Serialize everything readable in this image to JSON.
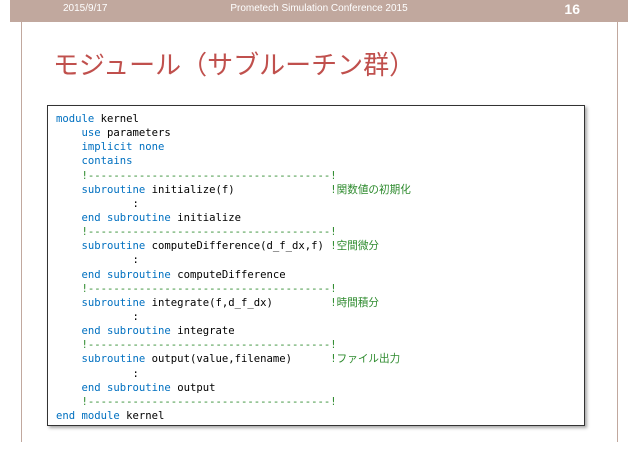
{
  "header": {
    "date": "2015/9/17",
    "conference": "Prometech Simulation Conference 2015",
    "page_number": "16"
  },
  "title": "モジュール（サブルーチン群）",
  "colors": {
    "header_bar": "#c1a89e",
    "title": "#c0504d",
    "keyword": "#0070c0",
    "comment": "#2e8b2e"
  },
  "code_lines": [
    [
      {
        "t": "module",
        "c": "kw"
      },
      {
        "t": " kernel",
        "c": ""
      }
    ],
    [
      {
        "t": "    ",
        "c": ""
      },
      {
        "t": "use",
        "c": "kw"
      },
      {
        "t": " parameters",
        "c": ""
      }
    ],
    [
      {
        "t": "    ",
        "c": ""
      },
      {
        "t": "implicit none",
        "c": "kw"
      }
    ],
    [
      {
        "t": "    ",
        "c": ""
      },
      {
        "t": "contains",
        "c": "kw"
      }
    ],
    [
      {
        "t": "    ",
        "c": ""
      },
      {
        "t": "!--------------------------------------!",
        "c": "cm"
      }
    ],
    [
      {
        "t": "    ",
        "c": ""
      },
      {
        "t": "subroutine",
        "c": "kw"
      },
      {
        "t": " initialize(f)               ",
        "c": ""
      },
      {
        "t": "!関数値の初期化",
        "c": "cm"
      }
    ],
    [
      {
        "t": "            :",
        "c": ""
      }
    ],
    [
      {
        "t": "    ",
        "c": ""
      },
      {
        "t": "end subroutine",
        "c": "kw"
      },
      {
        "t": " initialize",
        "c": ""
      }
    ],
    [
      {
        "t": "    ",
        "c": ""
      },
      {
        "t": "!--------------------------------------!",
        "c": "cm"
      }
    ],
    [
      {
        "t": "    ",
        "c": ""
      },
      {
        "t": "subroutine",
        "c": "kw"
      },
      {
        "t": " computeDifference(d_f_dx,f) ",
        "c": ""
      },
      {
        "t": "!空間微分",
        "c": "cm"
      }
    ],
    [
      {
        "t": "            :",
        "c": ""
      }
    ],
    [
      {
        "t": "    ",
        "c": ""
      },
      {
        "t": "end subroutine",
        "c": "kw"
      },
      {
        "t": " computeDifference",
        "c": ""
      }
    ],
    [
      {
        "t": "    ",
        "c": ""
      },
      {
        "t": "!--------------------------------------!",
        "c": "cm"
      }
    ],
    [
      {
        "t": "    ",
        "c": ""
      },
      {
        "t": "subroutine",
        "c": "kw"
      },
      {
        "t": " integrate(f,d_f_dx)         ",
        "c": ""
      },
      {
        "t": "!時間積分",
        "c": "cm"
      }
    ],
    [
      {
        "t": "            :",
        "c": ""
      }
    ],
    [
      {
        "t": "    ",
        "c": ""
      },
      {
        "t": "end subroutine",
        "c": "kw"
      },
      {
        "t": " integrate",
        "c": ""
      }
    ],
    [
      {
        "t": "    ",
        "c": ""
      },
      {
        "t": "!--------------------------------------!",
        "c": "cm"
      }
    ],
    [
      {
        "t": "    ",
        "c": ""
      },
      {
        "t": "subroutine",
        "c": "kw"
      },
      {
        "t": " output(value,filename)      ",
        "c": ""
      },
      {
        "t": "!ファイル出力",
        "c": "cm"
      }
    ],
    [
      {
        "t": "            :",
        "c": ""
      }
    ],
    [
      {
        "t": "    ",
        "c": ""
      },
      {
        "t": "end subroutine",
        "c": "kw"
      },
      {
        "t": " output",
        "c": ""
      }
    ],
    [
      {
        "t": "    ",
        "c": ""
      },
      {
        "t": "!--------------------------------------!",
        "c": "cm"
      }
    ],
    [
      {
        "t": "end module",
        "c": "kw"
      },
      {
        "t": " kernel",
        "c": ""
      }
    ]
  ]
}
